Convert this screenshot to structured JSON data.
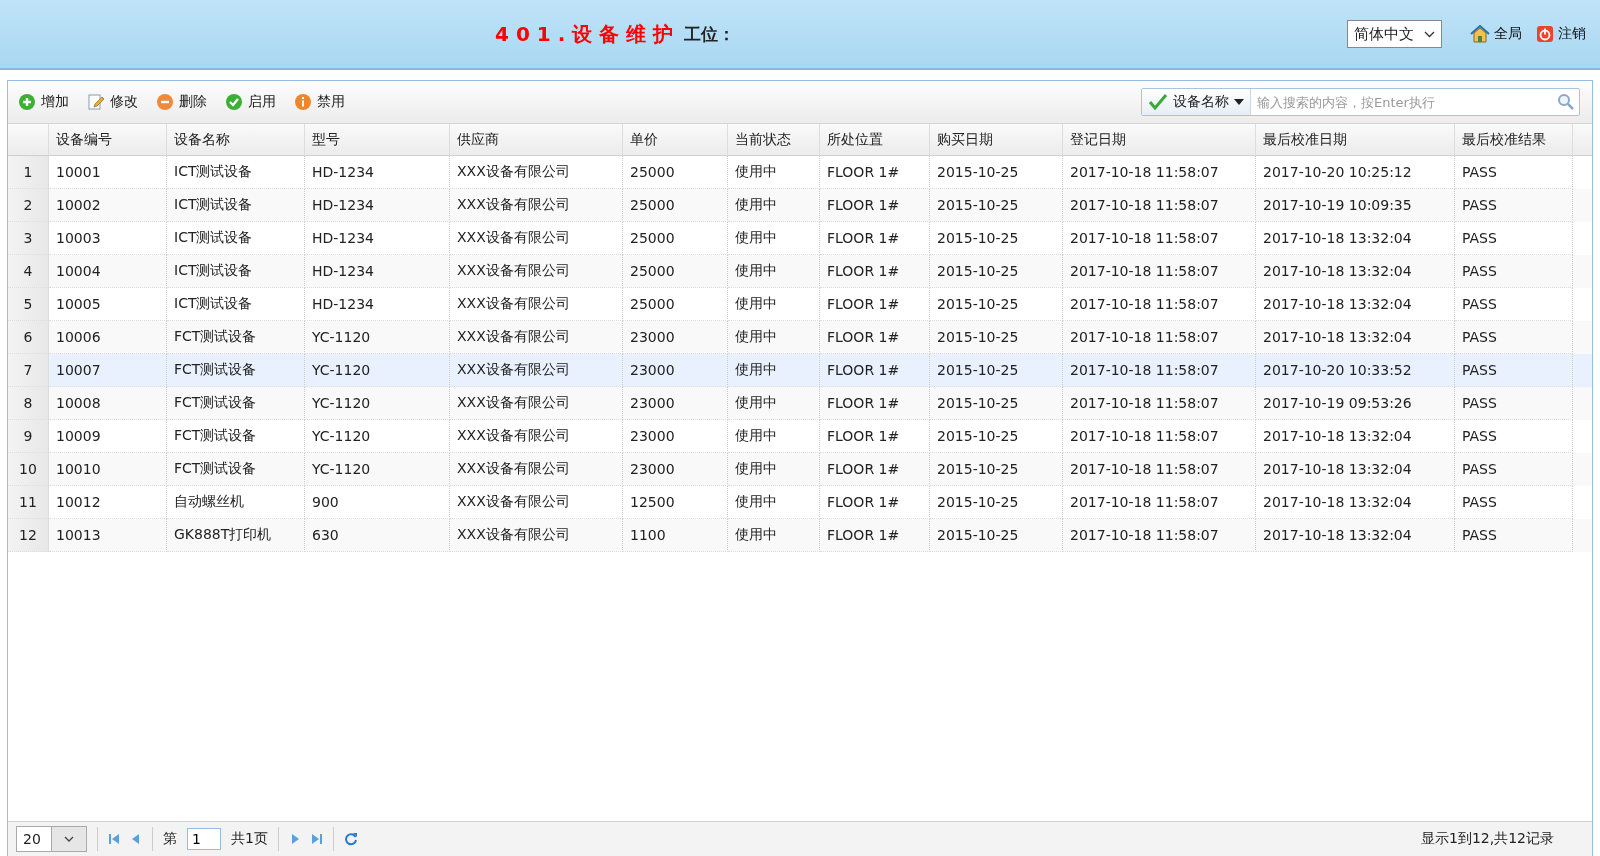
{
  "header": {
    "title": "401.设备维护",
    "station_label": "工位：",
    "language": {
      "value": "简体中文"
    },
    "links": [
      {
        "label": "全局",
        "kind": "home"
      },
      {
        "label": "注销",
        "kind": "logout"
      }
    ]
  },
  "toolbar": {
    "buttons": [
      {
        "label": "增加",
        "kind": "add"
      },
      {
        "label": "修改",
        "kind": "edit"
      },
      {
        "label": "删除",
        "kind": "delete"
      },
      {
        "label": "启用",
        "kind": "enable"
      },
      {
        "label": "禁用",
        "kind": "disable"
      }
    ],
    "search": {
      "field": "设备名称",
      "placeholder": "输入搜索的内容，按Enter执行"
    }
  },
  "table": {
    "columns": [
      "设备编号",
      "设备名称",
      "型号",
      "供应商",
      "单价",
      "当前状态",
      "所处位置",
      "购买日期",
      "登记日期",
      "最后校准日期",
      "最后校准结果"
    ],
    "rows": [
      {
        "number": "1",
        "selected": false,
        "cells": [
          "10001",
          "ICT测试设备",
          "HD-1234",
          "XXX设备有限公司",
          "25000",
          "使用中",
          "FLOOR 1#",
          "2015-10-25",
          "2017-10-18 11:58:07",
          "2017-10-20 10:25:12",
          "PASS"
        ]
      },
      {
        "number": "2",
        "selected": false,
        "cells": [
          "10002",
          "ICT测试设备",
          "HD-1234",
          "XXX设备有限公司",
          "25000",
          "使用中",
          "FLOOR 1#",
          "2015-10-25",
          "2017-10-18 11:58:07",
          "2017-10-19 10:09:35",
          "PASS"
        ]
      },
      {
        "number": "3",
        "selected": false,
        "cells": [
          "10003",
          "ICT测试设备",
          "HD-1234",
          "XXX设备有限公司",
          "25000",
          "使用中",
          "FLOOR 1#",
          "2015-10-25",
          "2017-10-18 11:58:07",
          "2017-10-18 13:32:04",
          "PASS"
        ]
      },
      {
        "number": "4",
        "selected": false,
        "cells": [
          "10004",
          "ICT测试设备",
          "HD-1234",
          "XXX设备有限公司",
          "25000",
          "使用中",
          "FLOOR 1#",
          "2015-10-25",
          "2017-10-18 11:58:07",
          "2017-10-18 13:32:04",
          "PASS"
        ]
      },
      {
        "number": "5",
        "selected": false,
        "cells": [
          "10005",
          "ICT测试设备",
          "HD-1234",
          "XXX设备有限公司",
          "25000",
          "使用中",
          "FLOOR 1#",
          "2015-10-25",
          "2017-10-18 11:58:07",
          "2017-10-18 13:32:04",
          "PASS"
        ]
      },
      {
        "number": "6",
        "selected": false,
        "cells": [
          "10006",
          "FCT测试设备",
          "YC-1120",
          "XXX设备有限公司",
          "23000",
          "使用中",
          "FLOOR 1#",
          "2015-10-25",
          "2017-10-18 11:58:07",
          "2017-10-18 13:32:04",
          "PASS"
        ]
      },
      {
        "number": "7",
        "selected": true,
        "cells": [
          "10007",
          "FCT测试设备",
          "YC-1120",
          "XXX设备有限公司",
          "23000",
          "使用中",
          "FLOOR 1#",
          "2015-10-25",
          "2017-10-18 11:58:07",
          "2017-10-20 10:33:52",
          "PASS"
        ]
      },
      {
        "number": "8",
        "selected": false,
        "cells": [
          "10008",
          "FCT测试设备",
          "YC-1120",
          "XXX设备有限公司",
          "23000",
          "使用中",
          "FLOOR 1#",
          "2015-10-25",
          "2017-10-18 11:58:07",
          "2017-10-19 09:53:26",
          "PASS"
        ]
      },
      {
        "number": "9",
        "selected": false,
        "cells": [
          "10009",
          "FCT测试设备",
          "YC-1120",
          "XXX设备有限公司",
          "23000",
          "使用中",
          "FLOOR 1#",
          "2015-10-25",
          "2017-10-18 11:58:07",
          "2017-10-18 13:32:04",
          "PASS"
        ]
      },
      {
        "number": "10",
        "selected": false,
        "cells": [
          "10010",
          "FCT测试设备",
          "YC-1120",
          "XXX设备有限公司",
          "23000",
          "使用中",
          "FLOOR 1#",
          "2015-10-25",
          "2017-10-18 11:58:07",
          "2017-10-18 13:32:04",
          "PASS"
        ]
      },
      {
        "number": "11",
        "selected": false,
        "cells": [
          "10012",
          "自动螺丝机",
          "900",
          "XXX设备有限公司",
          "12500",
          "使用中",
          "FLOOR 1#",
          "2015-10-25",
          "2017-10-18 11:58:07",
          "2017-10-18 13:32:04",
          "PASS"
        ]
      },
      {
        "number": "12",
        "selected": false,
        "cells": [
          "10013",
          "GK888T打印机",
          "630",
          "XXX设备有限公司",
          "1100",
          "使用中",
          "FLOOR 1#",
          "2015-10-25",
          "2017-10-18 11:58:07",
          "2017-10-18 13:32:04",
          "PASS"
        ]
      }
    ]
  },
  "pager": {
    "page_size": "20",
    "page_label": "第",
    "page": "1",
    "total_label": "共1页",
    "summary": "显示1到12,共12记录"
  }
}
